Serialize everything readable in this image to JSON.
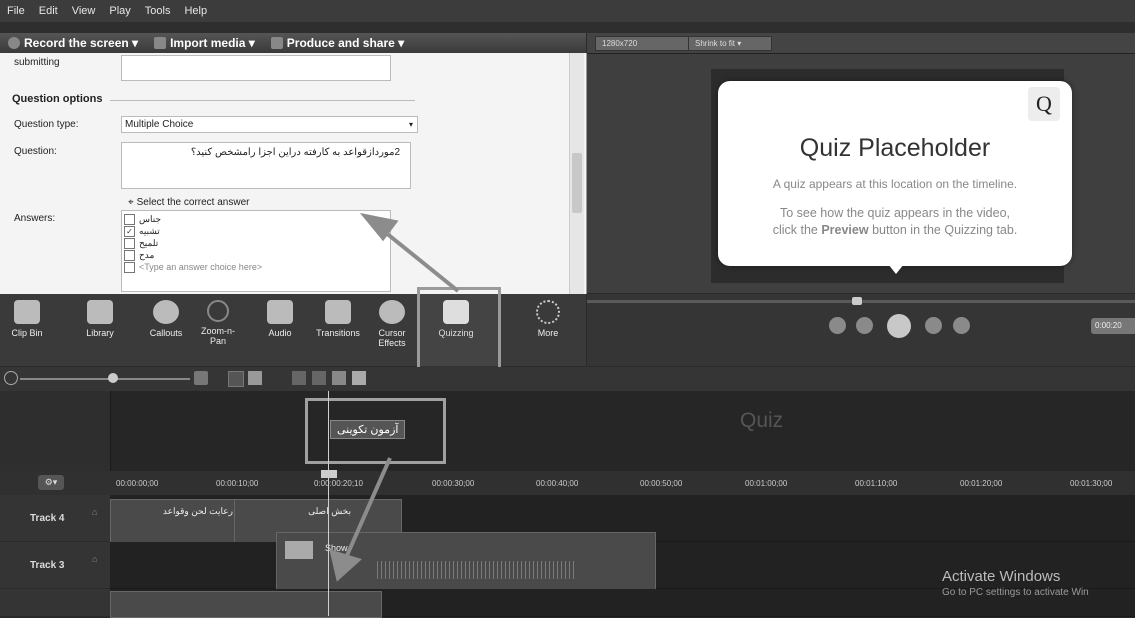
{
  "menu": [
    "File",
    "Edit",
    "View",
    "Play",
    "Tools",
    "Help"
  ],
  "toolbar": {
    "record": "Record the screen ▾",
    "import": "Import media ▾",
    "produce": "Produce and share ▾"
  },
  "properties": {
    "submitting_label": "submitting",
    "section_title": "Question options",
    "question_type_label": "Question type:",
    "question_type_value": "Multiple Choice",
    "question_label": "Question:",
    "question_value": "2موردازقواعد به کارفته دراین اجزا رامشخص کنید؟",
    "select_hint": "Select the correct answer",
    "answers_label": "Answers:",
    "answers": [
      {
        "text": "جناس",
        "checked": false
      },
      {
        "text": "تشبیه",
        "checked": true
      },
      {
        "text": "تلمیح",
        "checked": false
      },
      {
        "text": "مدح",
        "checked": false
      },
      {
        "text": "<Type an answer choice here>",
        "checked": false
      }
    ]
  },
  "preview": {
    "size": "1280x720",
    "zoom": "Shrink to fit ▾",
    "quiz_title": "Quiz Placeholder",
    "quiz_line1": "A quiz appears at this location on the timeline.",
    "quiz_line2a": "To see how the quiz appears in the video,",
    "quiz_line2b_pre": "click the ",
    "quiz_line2b_bold": "Preview",
    "quiz_line2b_post": " button in the Quizzing tab.",
    "time": "0:00:20"
  },
  "tools": [
    "Clip Bin",
    "Library",
    "Callouts",
    "Zoom-n-Pan",
    "Audio",
    "Transitions",
    "Cursor Effects",
    "Quizzing",
    "More"
  ],
  "timeline": {
    "quiz_lane_label": "Quiz",
    "quiz_tag": "آزمون تکوینی",
    "ticks": [
      "00:00:00;00",
      "00:00:10;00",
      "0:00:00:20;10",
      "00:00:30;00",
      "00:00:40;00",
      "00:00:50;00",
      "00:01:00;00",
      "00:01:10;00",
      "00:01:20;00",
      "00:01:30;00"
    ],
    "tracks": [
      {
        "name": "Track 4",
        "clips": [
          "رعایت لحن وقواعد",
          "بخش اصلی"
        ]
      },
      {
        "name": "Track 3",
        "clips": [
          "Show"
        ]
      }
    ]
  },
  "watermark": {
    "line1": "Activate Windows",
    "line2": "Go to PC settings to activate Win"
  }
}
